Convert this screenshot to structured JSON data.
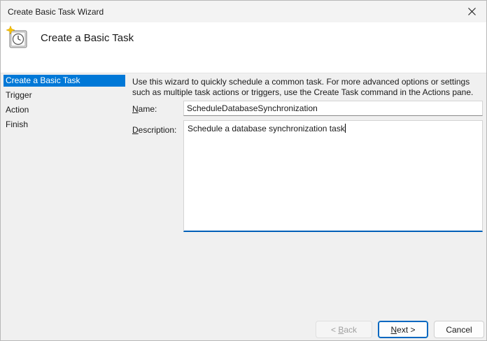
{
  "window": {
    "title": "Create Basic Task Wizard"
  },
  "header": {
    "heading": "Create a Basic Task",
    "icon": "clock-sparkle-icon"
  },
  "steps": [
    {
      "label": "Create a Basic Task",
      "active": true
    },
    {
      "label": "Trigger",
      "active": false
    },
    {
      "label": "Action",
      "active": false
    },
    {
      "label": "Finish",
      "active": false
    }
  ],
  "content": {
    "intro": "Use this wizard to quickly schedule a common task.  For more advanced options or settings such as multiple task actions or triggers, use the Create Task command in the Actions pane.",
    "name_label_access": "N",
    "name_label_rest": "ame:",
    "name_value": "ScheduleDatabaseSynchronization",
    "desc_label_access": "D",
    "desc_label_rest": "escription:",
    "desc_value": "Schedule a database synchronization task"
  },
  "buttons": {
    "back_prefix": "< ",
    "back_access": "B",
    "back_rest": "ack",
    "next_access": "N",
    "next_rest": "ext >",
    "cancel": "Cancel"
  },
  "colors": {
    "accent": "#0078d7",
    "focus_border": "#005fb8"
  }
}
